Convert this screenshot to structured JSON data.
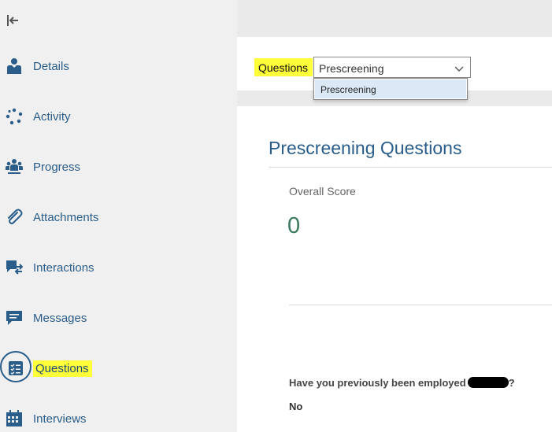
{
  "sidebar": {
    "items": [
      {
        "label": "Details",
        "icon": "person-icon"
      },
      {
        "label": "Activity",
        "icon": "activity-ring-icon"
      },
      {
        "label": "Progress",
        "icon": "progress-people-icon"
      },
      {
        "label": "Attachments",
        "icon": "paperclip-icon"
      },
      {
        "label": "Interactions",
        "icon": "chat-arrows-icon"
      },
      {
        "label": "Messages",
        "icon": "message-icon"
      },
      {
        "label": "Questions",
        "icon": "checklist-icon"
      },
      {
        "label": "Interviews",
        "icon": "calendar-icon"
      }
    ],
    "active": "Questions"
  },
  "toolbar": {
    "questions_label": "Questions",
    "select_value": "Prescreening",
    "dropdown_options": [
      "Prescreening"
    ]
  },
  "panel": {
    "title": "Prescreening Questions",
    "score_label": "Overall Score",
    "score_value": "0",
    "question_text": "Have you previously been employed",
    "question_suffix": "?",
    "answer": "No"
  },
  "colors": {
    "accent": "#2a5d8a",
    "highlight": "#ffff3a",
    "score": "#3b7a5f",
    "sidebar_bg": "#f0f0f0"
  }
}
